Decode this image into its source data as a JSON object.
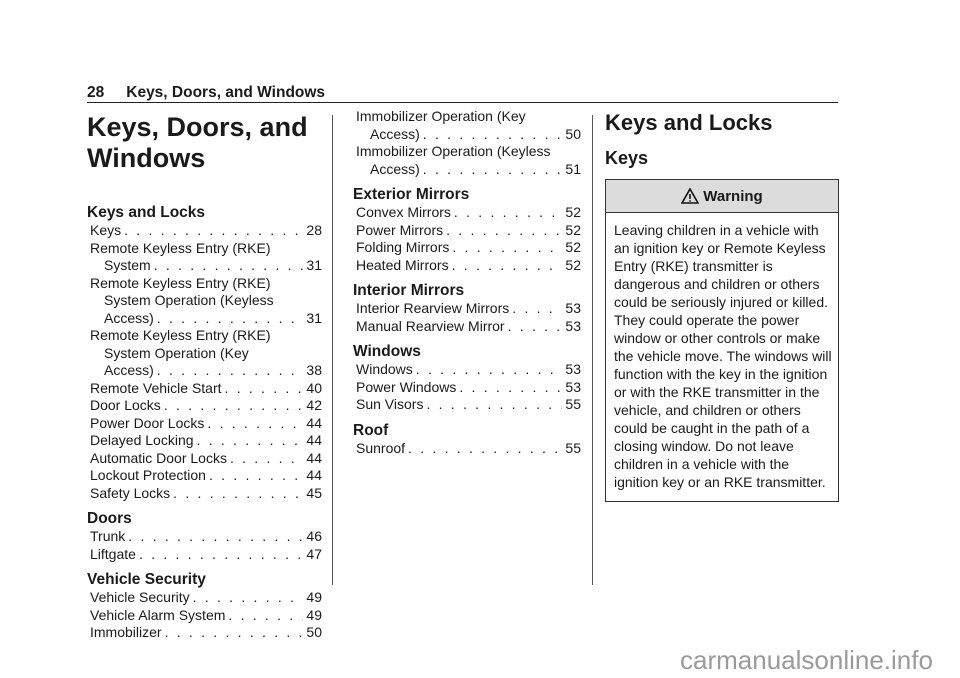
{
  "header": {
    "page_number": "28",
    "title": "Keys, Doors, and Windows"
  },
  "toc": {
    "title_lines": [
      "Keys, Doors, and",
      "Windows"
    ],
    "columns": [
      [
        {
          "heading": "Keys and Locks",
          "entries": [
            {
              "lines": [
                "Keys"
              ],
              "page": "28"
            },
            {
              "lines": [
                "Remote Keyless Entry (RKE)",
                "System"
              ],
              "page": "31"
            },
            {
              "lines": [
                "Remote Keyless Entry (RKE)",
                "System Operation (Keyless",
                "Access)"
              ],
              "page": "31"
            },
            {
              "lines": [
                "Remote Keyless Entry (RKE)",
                "System Operation (Key",
                "Access)"
              ],
              "page": "38"
            },
            {
              "lines": [
                "Remote Vehicle Start"
              ],
              "page": "40"
            },
            {
              "lines": [
                "Door Locks"
              ],
              "page": "42"
            },
            {
              "lines": [
                "Power Door Locks"
              ],
              "page": "44"
            },
            {
              "lines": [
                "Delayed Locking"
              ],
              "page": "44"
            },
            {
              "lines": [
                "Automatic Door Locks"
              ],
              "page": "44"
            },
            {
              "lines": [
                "Lockout Protection"
              ],
              "page": "44"
            },
            {
              "lines": [
                "Safety Locks"
              ],
              "page": "45"
            }
          ]
        },
        {
          "heading": "Doors",
          "entries": [
            {
              "lines": [
                "Trunk"
              ],
              "page": "46"
            },
            {
              "lines": [
                "Liftgate"
              ],
              "page": "47"
            }
          ]
        },
        {
          "heading": "Vehicle Security",
          "entries": [
            {
              "lines": [
                "Vehicle Security"
              ],
              "page": "49"
            },
            {
              "lines": [
                "Vehicle Alarm System"
              ],
              "page": "49"
            },
            {
              "lines": [
                "Immobilizer"
              ],
              "page": "50"
            }
          ]
        }
      ],
      [
        {
          "heading": "",
          "entries": [
            {
              "lines": [
                "Immobilizer Operation (Key",
                "Access)"
              ],
              "page": "50"
            },
            {
              "lines": [
                "Immobilizer Operation (Keyless",
                "Access)"
              ],
              "page": "51"
            }
          ]
        },
        {
          "heading": "Exterior Mirrors",
          "entries": [
            {
              "lines": [
                "Convex Mirrors"
              ],
              "page": "52"
            },
            {
              "lines": [
                "Power Mirrors"
              ],
              "page": "52"
            },
            {
              "lines": [
                "Folding Mirrors"
              ],
              "page": "52"
            },
            {
              "lines": [
                "Heated Mirrors"
              ],
              "page": "52"
            }
          ]
        },
        {
          "heading": "Interior Mirrors",
          "entries": [
            {
              "lines": [
                "Interior Rearview Mirrors"
              ],
              "page": "53"
            },
            {
              "lines": [
                "Manual Rearview Mirror"
              ],
              "page": "53"
            }
          ]
        },
        {
          "heading": "Windows",
          "entries": [
            {
              "lines": [
                "Windows"
              ],
              "page": "53"
            },
            {
              "lines": [
                "Power Windows"
              ],
              "page": "53"
            },
            {
              "lines": [
                "Sun Visors"
              ],
              "page": "55"
            }
          ]
        },
        {
          "heading": "Roof",
          "entries": [
            {
              "lines": [
                "Sunroof"
              ],
              "page": "55"
            }
          ]
        }
      ]
    ]
  },
  "content": {
    "section_title": "Keys and Locks",
    "subsection_title": "Keys",
    "warning": {
      "icon": "warning-triangle-icon",
      "label": "Warning",
      "text": "Leaving children in a vehicle with an ignition key or Remote Keyless Entry (RKE) transmitter is dangerous and children or others could be seriously injured or killed. They could operate the power window or other controls or make the vehicle move. The windows will function with the key in the ignition or with the RKE transmitter in the vehicle, and children or others could be caught in the path of a closing window. Do not leave children in a vehicle with the ignition key or an RKE transmitter."
    }
  },
  "watermark": "carmanualsonline.info"
}
